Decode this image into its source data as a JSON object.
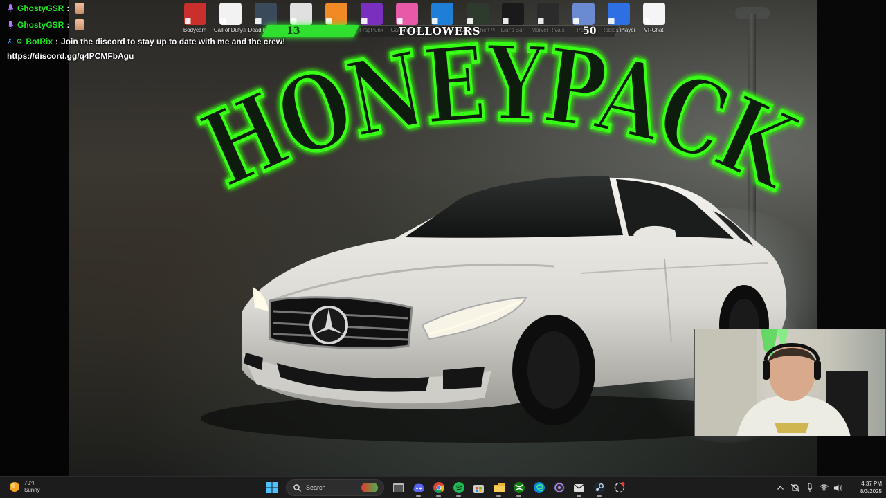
{
  "chat": {
    "lines": [
      {
        "user": "GhostyGSR",
        "message": ""
      },
      {
        "user": "GhostyGSR",
        "message": ""
      },
      {
        "user": "BotRix",
        "message": "Join the discord to stay up to date with me and the crew!"
      }
    ],
    "link": "https://discord.gg/q4PCMFbAgu"
  },
  "desktop_icons": [
    {
      "label": "Bodycam",
      "icon": "bodycam-icon",
      "color": "#c9302c"
    },
    {
      "label": "Call of Duty®",
      "icon": "document-icon",
      "color": "#f2f2f2"
    },
    {
      "label": "Dead by Daylight",
      "icon": "dbd-icon",
      "color": "#3b4a5a"
    },
    {
      "label": "",
      "icon": "arrow-a-icon",
      "color": "#e0e0e0"
    },
    {
      "label": "",
      "icon": "fall-guys-icon",
      "color": "#f08a24"
    },
    {
      "label": "FragPunk",
      "icon": "fragpunk-icon",
      "color": "#7b2fbf"
    },
    {
      "label": "Gang Beasts",
      "icon": "gang-icon",
      "color": "#e85aa8"
    },
    {
      "label": "",
      "icon": "gmod-icon",
      "color": "#1f7ed8"
    },
    {
      "label": "Grand Theft Auto V",
      "icon": "gta-icon",
      "color": "#2d3a2d"
    },
    {
      "label": "Liar's Bar",
      "icon": "liars-bar-icon",
      "color": "#1a1a1a"
    },
    {
      "label": "Marvel Rivals",
      "icon": "marvel-rivals-icon",
      "color": "#2b2b2b"
    },
    {
      "label": "Peak",
      "icon": "peak-icon",
      "color": "#6a8bd0"
    },
    {
      "label": "Roblox Player",
      "icon": "roblox-icon",
      "color": "#2f6fe4"
    },
    {
      "label": "VRChat",
      "icon": "vrchat-icon",
      "color": "#f5f5f5"
    }
  ],
  "goal": {
    "title": "FOLLOWERS",
    "current": "13",
    "target": "50",
    "progress": 0.26
  },
  "wallpaper": {
    "logo_text": "HONEYPACK",
    "neon_color": "#39ff14"
  },
  "taskbar": {
    "weather_temp": "79°F",
    "weather_desc": "Sunny",
    "search_placeholder": "Search",
    "time": "4:37 PM",
    "date": "8/3/2025",
    "apps": [
      "file-explorer",
      "discord",
      "chrome",
      "spotify",
      "store",
      "folder",
      "xbox",
      "edge",
      "obs",
      "email",
      "steam",
      "chatgpt"
    ]
  }
}
